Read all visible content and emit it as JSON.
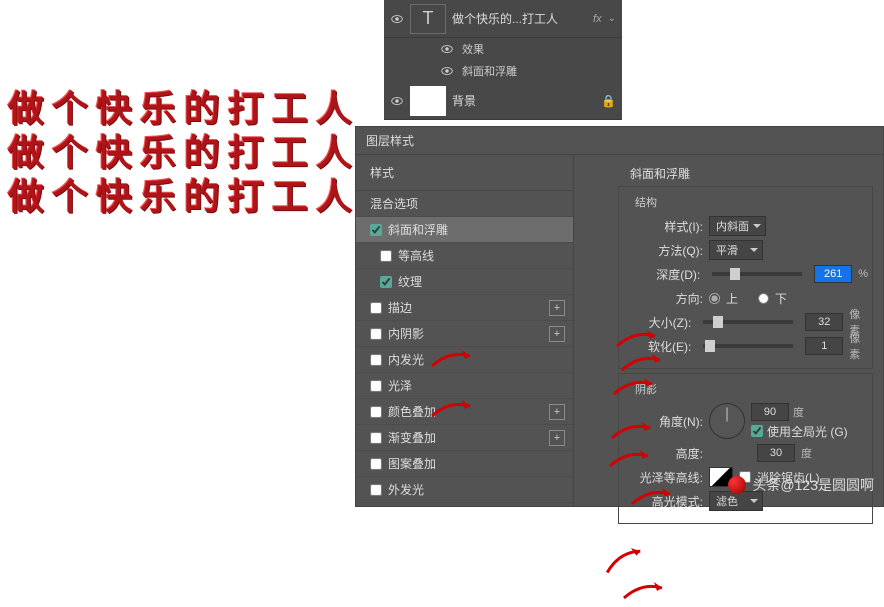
{
  "canvas": {
    "text": "做个快乐的打工人"
  },
  "layers": {
    "text_layer_name": "做个快乐的...打工人",
    "fx_tag": "fx",
    "effects_label": "效果",
    "bevel_label": "斜面和浮雕",
    "background_label": "背景"
  },
  "dialog": {
    "title": "图层样式",
    "styles_header": "样式",
    "blend_options": "混合选项",
    "items": {
      "bevel": "斜面和浮雕",
      "contour": "等高线",
      "texture": "纹理",
      "stroke": "描边",
      "inner_shadow": "内阴影",
      "inner_glow": "内发光",
      "satin": "光泽",
      "color_overlay": "颜色叠加",
      "gradient_overlay": "渐变叠加",
      "pattern_overlay": "图案叠加",
      "outer_glow": "外发光"
    }
  },
  "settings": {
    "section_title": "斜面和浮雕",
    "structure_title": "结构",
    "style_label": "样式(I):",
    "style_value": "内斜面",
    "technique_label": "方法(Q):",
    "technique_value": "平滑",
    "depth_label": "深度(D):",
    "depth_value": "261",
    "depth_unit": "%",
    "direction_label": "方向:",
    "up_label": "上",
    "down_label": "下",
    "size_label": "大小(Z):",
    "size_value": "32",
    "size_unit": "像素",
    "soften_label": "软化(E):",
    "soften_value": "1",
    "soften_unit": "像素",
    "shading_title": "阴影",
    "angle_label": "角度(N):",
    "angle_value": "90",
    "angle_unit": "度",
    "global_light_label": "使用全局光 (G)",
    "altitude_label": "高度:",
    "altitude_value": "30",
    "altitude_unit": "度",
    "gloss_contour_label": "光泽等高线:",
    "antialias_label": "消除锯齿(L)",
    "highlight_mode_label": "高光模式:",
    "highlight_mode_value": "滤色"
  },
  "watermark": {
    "text": "头条@123是圆圆啊"
  }
}
